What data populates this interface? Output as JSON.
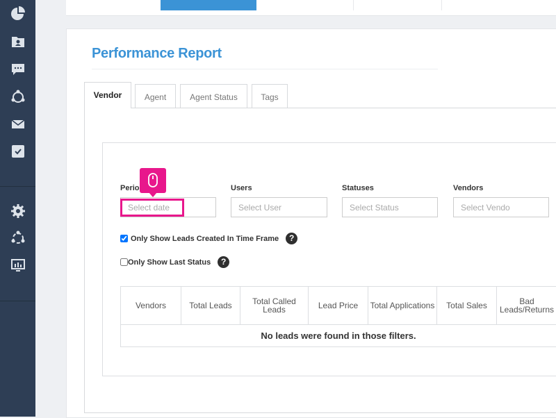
{
  "page": {
    "title": "Performance Report"
  },
  "tabs": [
    {
      "label": "Vendor"
    },
    {
      "label": "Agent"
    },
    {
      "label": "Agent Status"
    },
    {
      "label": "Tags"
    }
  ],
  "filters": {
    "period": {
      "label": "Period",
      "placeholder": "Select date"
    },
    "users": {
      "label": "Users",
      "placeholder": "Select User"
    },
    "statuses": {
      "label": "Statuses",
      "placeholder": "Select Status"
    },
    "vendors": {
      "label": "Vendors",
      "placeholder": "Select Vendo"
    }
  },
  "options": {
    "time_frame": {
      "label": "Only Show Leads Created In Time Frame",
      "checked": true
    },
    "last_status": {
      "label": "Only Show Last Status",
      "checked": false
    },
    "help_glyph": "?"
  },
  "table": {
    "columns": [
      "Vendors",
      "Total Leads",
      "Total Called Leads",
      "Lead Price",
      "Total Applications",
      "Total Sales",
      "Bad Leads/Returns"
    ],
    "empty_message": "No leads were found in those filters."
  },
  "sidebar": {
    "icons": [
      "pie-chart-icon",
      "contacts-folder-icon",
      "chat-icon",
      "network-icon",
      "mail-icon",
      "task-check-icon",
      "gear-icon",
      "integrations-icon",
      "monitor-icon"
    ]
  },
  "colors": {
    "accent": "#3b93d6",
    "highlight": "#e8178c",
    "sidebar": "#2e3e55"
  }
}
